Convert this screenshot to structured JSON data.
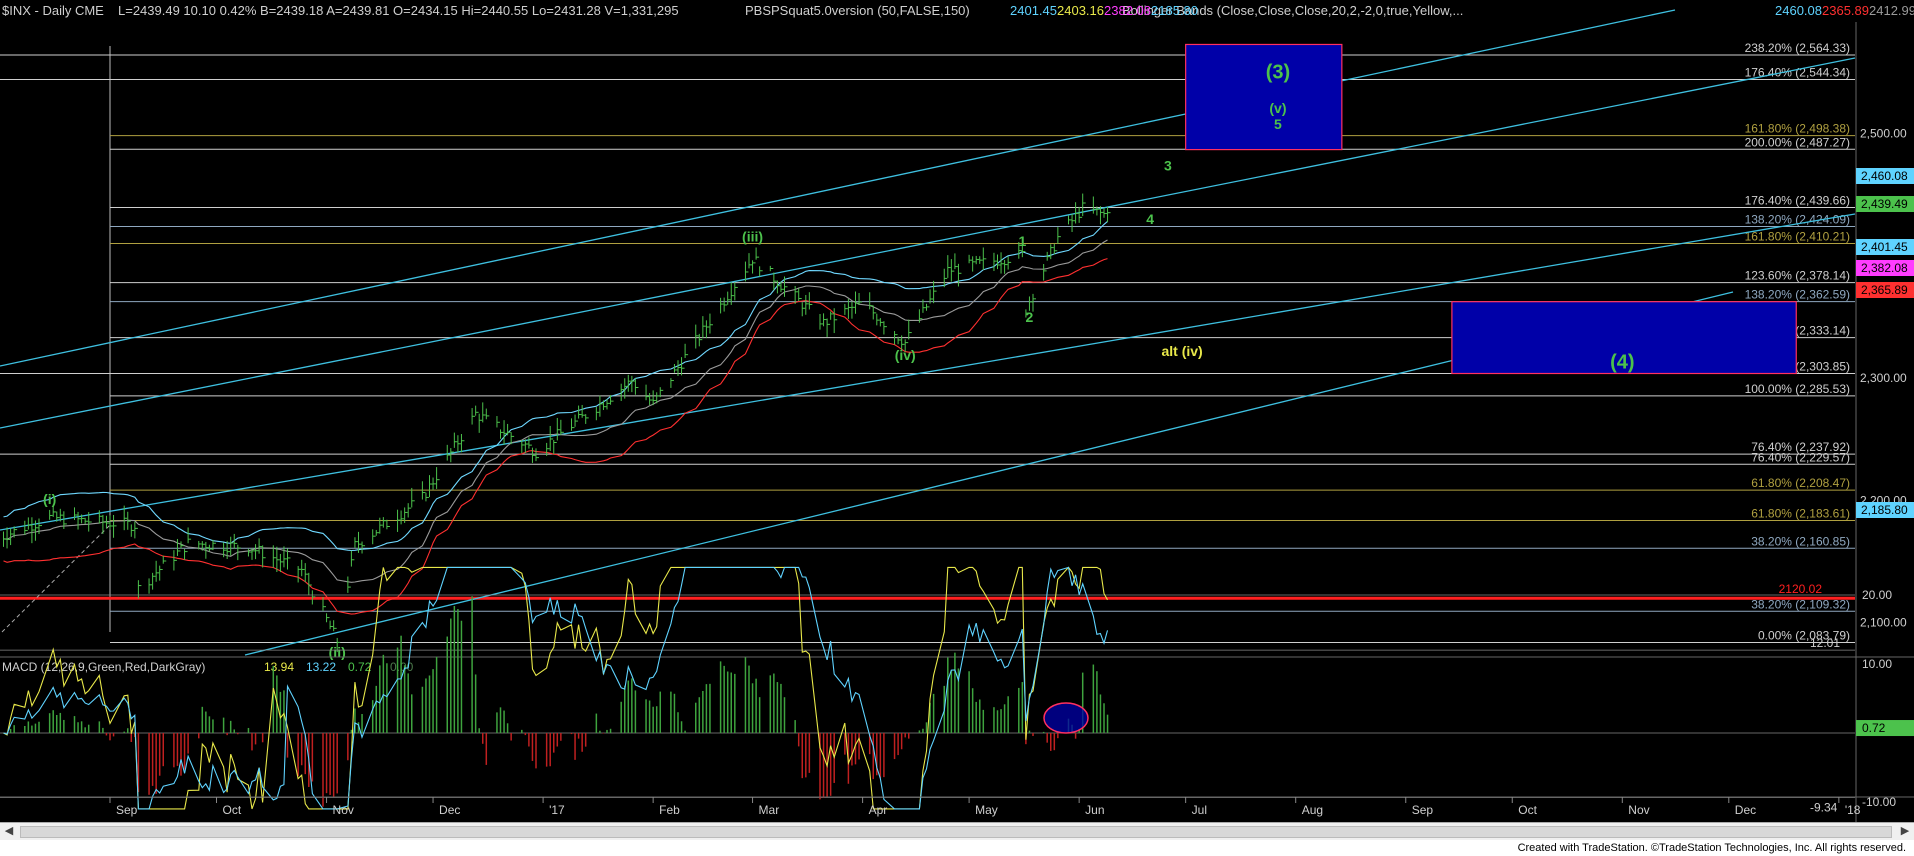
{
  "header": {
    "symbol": "$INX - Daily  CME",
    "stats": "L=2439.49  10.10  0.42%  B=2439.18  A=2439.81  O=2434.15  Hi=2440.55  Lo=2431.28  V=1,331,295",
    "indicator1": "PBSPSquat5.0version (50,FALSE,150)",
    "ind1_vals": [
      "2401.45",
      "2403.16",
      "2382.08",
      "2185.80"
    ],
    "ind1_colors": [
      "#5fd3ff",
      "#e8e84a",
      "#ff3cff",
      "#5fd3ff"
    ],
    "indicator2": "Bollinger Bands (Close,Close,Close,20,2,-2,0,true,Yellow,...",
    "ind2_vals": [
      "2460.08",
      "2365.89",
      "2412.99"
    ],
    "ind2_colors": [
      "#5fd3ff",
      "#ff3030",
      "#9a9a9a"
    ]
  },
  "macd": {
    "label": "MACD (12,26,9,Green,Red,DarkGray)",
    "vals": [
      "13.94",
      "13.22",
      "0.72",
      "0.00"
    ],
    "val_colors": [
      "#e8e84a",
      "#5fd3ff",
      "#4cc24c",
      "#4c7a4c"
    ],
    "axis_ticks": [
      "20.00",
      "10.00",
      "-10.00"
    ],
    "right_labels": [
      {
        "text": "12.01",
        "color": "#cfcfcf"
      },
      {
        "text": "0.72",
        "color": "#000",
        "bg": "#4cc24c"
      },
      {
        "text": "-9.34",
        "color": "#cfcfcf"
      }
    ],
    "ylim": [
      -12,
      25
    ]
  },
  "chart_data": {
    "type": "candlestick",
    "x_ticks": [
      "Sep",
      "Oct",
      "Nov",
      "Dec",
      "'17",
      "Feb",
      "Mar",
      "Apr",
      "May",
      "Jun",
      "Jul",
      "Aug",
      "Sep",
      "Oct",
      "Nov",
      "Dec",
      "'18"
    ],
    "ylim": [
      2070,
      2585
    ],
    "y_ticks": [
      "2,500.00",
      "2,300.00",
      "2,200.00",
      "2,100.00"
    ],
    "last_price": "2,439.49",
    "price_tags": [
      {
        "text": "2,460.08",
        "color": "#5fd3ff"
      },
      {
        "text": "2,439.49",
        "color": "#4cc24c"
      },
      {
        "text": "2,401.45",
        "color": "#5fd3ff"
      },
      {
        "text": "2,382.08",
        "color": "#ff3cff"
      },
      {
        "text": "2,365.89",
        "color": "#ff3030"
      },
      {
        "text": "2,185.80",
        "color": "#5fd3ff"
      }
    ],
    "fib_levels": [
      {
        "text": "238.20% (2,564.33)",
        "value": 2564.33,
        "color": "#cfcfcf"
      },
      {
        "text": "176.40% (2,544.34)",
        "value": 2544.34,
        "color": "#cfcfcf"
      },
      {
        "text": "161.80% (2,498.38)",
        "value": 2498.38,
        "color": "#b0a040"
      },
      {
        "text": "200.00% (2,487.27)",
        "value": 2487.27,
        "color": "#cfcfcf"
      },
      {
        "text": "176.40% (2,439.66)",
        "value": 2439.66,
        "color": "#cfcfcf"
      },
      {
        "text": "138.20% (2,424.09)",
        "value": 2424.09,
        "color": "#8fa8c0"
      },
      {
        "text": "161.80% (2,410.21)",
        "value": 2410.21,
        "color": "#b0a040"
      },
      {
        "text": "123.60% (2,378.14)",
        "value": 2378.14,
        "color": "#cfcfcf"
      },
      {
        "text": "138.20% (2,362.59)",
        "value": 2362.59,
        "color": "#8fa8c0"
      },
      {
        "text": "123.60% (2,333.14)",
        "value": 2333.14,
        "color": "#cfcfcf"
      },
      {
        "text": "100.00% (2,303.85)",
        "value": 2303.85,
        "color": "#cfcfcf"
      },
      {
        "text": "100.00% (2,285.53)",
        "value": 2285.53,
        "color": "#cfcfcf"
      },
      {
        "text": "76.40% (2,237.92)",
        "value": 2237.92,
        "color": "#cfcfcf"
      },
      {
        "text": "76.40% (2,229.57)",
        "value": 2229.57,
        "color": "#cfcfcf"
      },
      {
        "text": "61.80% (2,208.47)",
        "value": 2208.47,
        "color": "#b0a040"
      },
      {
        "text": "61.80% (2,183.61)",
        "value": 2183.61,
        "color": "#b0a040"
      },
      {
        "text": "38.20% (2,160.85)",
        "value": 2160.85,
        "color": "#8fa8c0"
      },
      {
        "text": "38.20% (2,109.32)",
        "value": 2109.32,
        "color": "#8fa8c0"
      },
      {
        "text": "0.00% (2,083.79)",
        "value": 2083.79,
        "color": "#cfcfcf"
      }
    ],
    "support_line": {
      "text": "2120.02",
      "value": 2120.02,
      "color": "#ff2020"
    },
    "wave_labels": [
      {
        "text": "(i)",
        "date": "2016-08-15",
        "price": 2197,
        "color": "#4cc24c"
      },
      {
        "text": "(ii)",
        "date": "2016-11-04",
        "price": 2072,
        "color": "#4cc24c"
      },
      {
        "text": "(iii)",
        "date": "2017-03-01",
        "price": 2412,
        "color": "#4cc24c"
      },
      {
        "text": "(iv)",
        "date": "2017-04-13",
        "price": 2315,
        "color": "#4cc24c"
      },
      {
        "text": "alt (iv)",
        "date": "2017-06-30",
        "price": 2318,
        "color": "#e8e84a"
      },
      {
        "text": "1",
        "date": "2017-05-16",
        "price": 2408,
        "color": "#4cc24c"
      },
      {
        "text": "2",
        "date": "2017-05-18",
        "price": 2346,
        "color": "#4cc24c"
      },
      {
        "text": "3",
        "date": "2017-06-26",
        "price": 2470,
        "color": "#4cc24c"
      },
      {
        "text": "4",
        "date": "2017-06-21",
        "price": 2426,
        "color": "#4cc24c"
      },
      {
        "text": "(3)",
        "date": "2017-07-27",
        "price": 2545,
        "color": "#4cc24c"
      },
      {
        "text": "(v)",
        "date": "2017-07-27",
        "price": 2517,
        "color": "#4cc24c"
      },
      {
        "text": "5",
        "date": "2017-07-27",
        "price": 2504,
        "color": "#4cc24c"
      },
      {
        "text": "(4)",
        "date": "2017-11-01",
        "price": 2308,
        "color": "#4cc24c"
      }
    ],
    "target_boxes": [
      {
        "name": "wave-3-target",
        "start": "2017-07-01",
        "end": "2017-08-14",
        "top": 2573,
        "bottom": 2487
      },
      {
        "name": "wave-4-target",
        "start": "2017-09-14",
        "end": "2017-12-20",
        "top": 2362.59,
        "bottom": 2303.85
      }
    ]
  },
  "footer": {
    "credit": "Created with TradeStation. ©TradeStation Technologies, Inc. All rights reserved."
  }
}
